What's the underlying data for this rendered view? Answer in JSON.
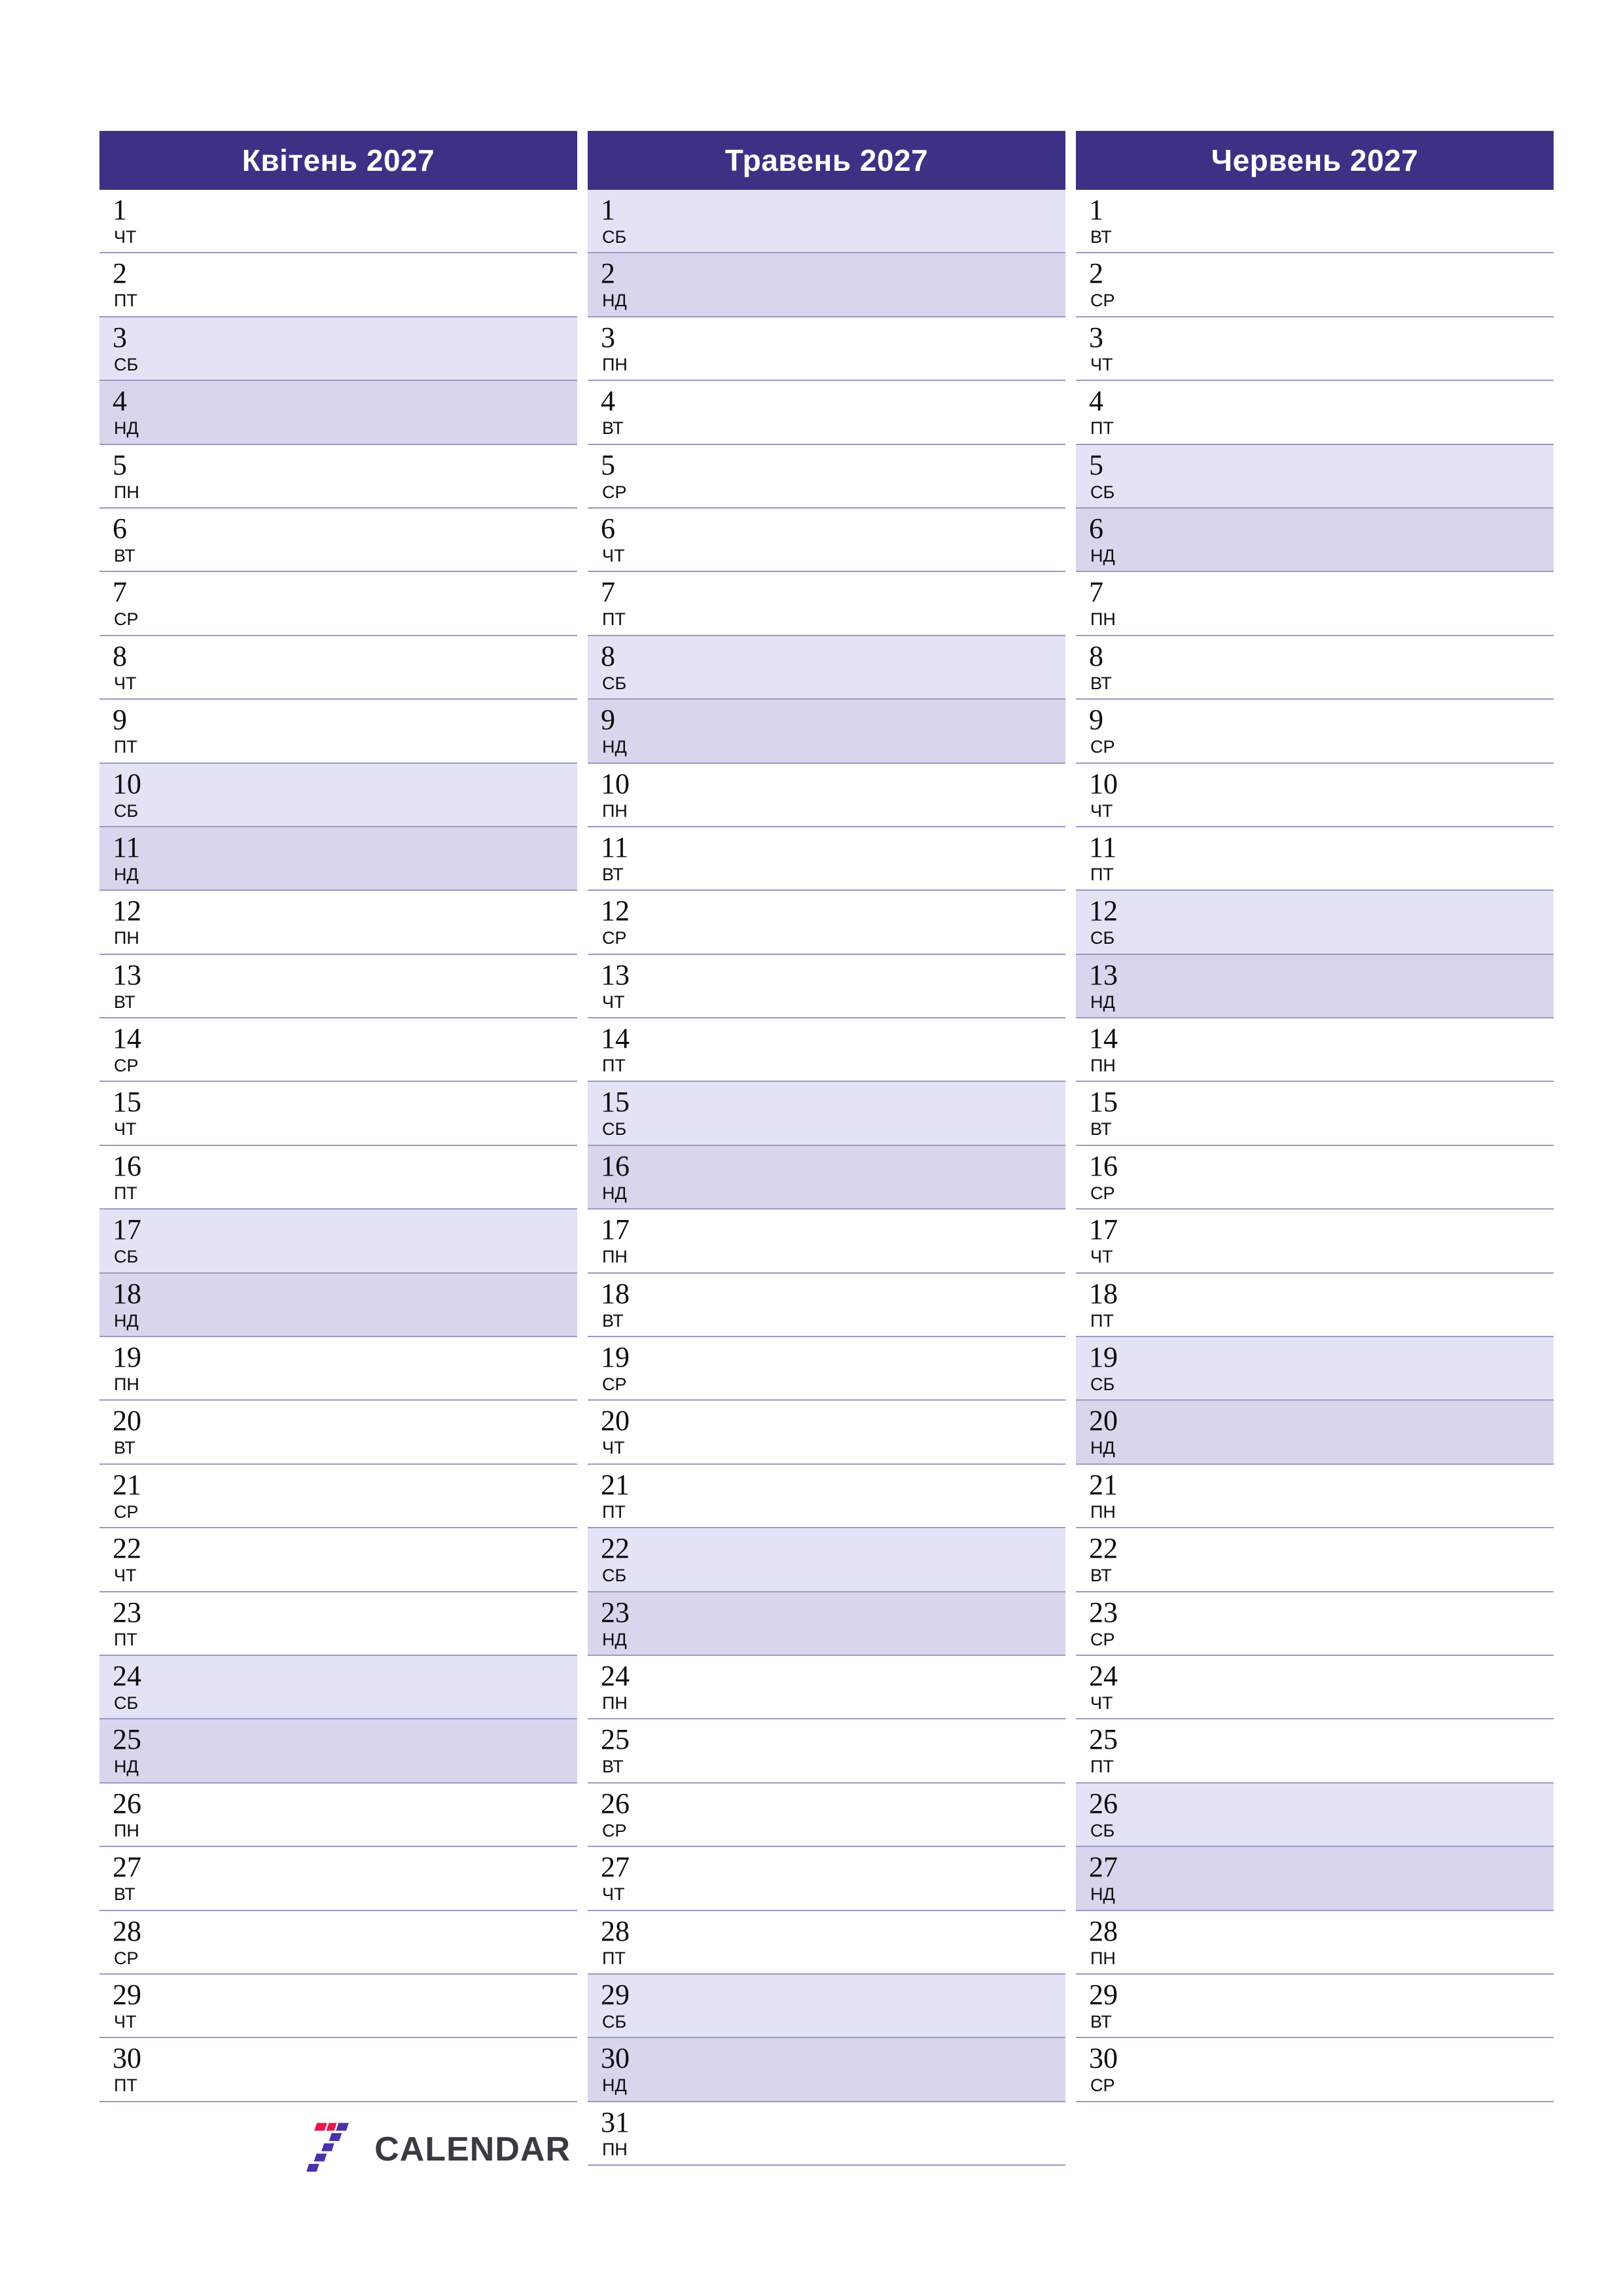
{
  "document": {
    "type": "quarterly-planner",
    "logo": {
      "text": "CALENDAR",
      "mark_colors": [
        "#e8174a",
        "#4b31a8"
      ]
    },
    "colors": {
      "header_bg": "#3b3185",
      "header_text": "#ffffff",
      "saturday_bg": "#e3e3f6",
      "sunday_bg": "#d9d5ec",
      "row_border": "#9a9ac4",
      "day_text": "#0d0d0d"
    }
  },
  "months": [
    {
      "title": "Квітень 2027",
      "days": [
        {
          "num": "1",
          "dow": "ЧТ"
        },
        {
          "num": "2",
          "dow": "ПТ"
        },
        {
          "num": "3",
          "dow": "СБ"
        },
        {
          "num": "4",
          "dow": "НД"
        },
        {
          "num": "5",
          "dow": "ПН"
        },
        {
          "num": "6",
          "dow": "ВТ"
        },
        {
          "num": "7",
          "dow": "СР"
        },
        {
          "num": "8",
          "dow": "ЧТ"
        },
        {
          "num": "9",
          "dow": "ПТ"
        },
        {
          "num": "10",
          "dow": "СБ"
        },
        {
          "num": "11",
          "dow": "НД"
        },
        {
          "num": "12",
          "dow": "ПН"
        },
        {
          "num": "13",
          "dow": "ВТ"
        },
        {
          "num": "14",
          "dow": "СР"
        },
        {
          "num": "15",
          "dow": "ЧТ"
        },
        {
          "num": "16",
          "dow": "ПТ"
        },
        {
          "num": "17",
          "dow": "СБ"
        },
        {
          "num": "18",
          "dow": "НД"
        },
        {
          "num": "19",
          "dow": "ПН"
        },
        {
          "num": "20",
          "dow": "ВТ"
        },
        {
          "num": "21",
          "dow": "СР"
        },
        {
          "num": "22",
          "dow": "ЧТ"
        },
        {
          "num": "23",
          "dow": "ПТ"
        },
        {
          "num": "24",
          "dow": "СБ"
        },
        {
          "num": "25",
          "dow": "НД"
        },
        {
          "num": "26",
          "dow": "ПН"
        },
        {
          "num": "27",
          "dow": "ВТ"
        },
        {
          "num": "28",
          "dow": "СР"
        },
        {
          "num": "29",
          "dow": "ЧТ"
        },
        {
          "num": "30",
          "dow": "ПТ"
        }
      ]
    },
    {
      "title": "Травень 2027",
      "days": [
        {
          "num": "1",
          "dow": "СБ"
        },
        {
          "num": "2",
          "dow": "НД"
        },
        {
          "num": "3",
          "dow": "ПН"
        },
        {
          "num": "4",
          "dow": "ВТ"
        },
        {
          "num": "5",
          "dow": "СР"
        },
        {
          "num": "6",
          "dow": "ЧТ"
        },
        {
          "num": "7",
          "dow": "ПТ"
        },
        {
          "num": "8",
          "dow": "СБ"
        },
        {
          "num": "9",
          "dow": "НД"
        },
        {
          "num": "10",
          "dow": "ПН"
        },
        {
          "num": "11",
          "dow": "ВТ"
        },
        {
          "num": "12",
          "dow": "СР"
        },
        {
          "num": "13",
          "dow": "ЧТ"
        },
        {
          "num": "14",
          "dow": "ПТ"
        },
        {
          "num": "15",
          "dow": "СБ"
        },
        {
          "num": "16",
          "dow": "НД"
        },
        {
          "num": "17",
          "dow": "ПН"
        },
        {
          "num": "18",
          "dow": "ВТ"
        },
        {
          "num": "19",
          "dow": "СР"
        },
        {
          "num": "20",
          "dow": "ЧТ"
        },
        {
          "num": "21",
          "dow": "ПТ"
        },
        {
          "num": "22",
          "dow": "СБ"
        },
        {
          "num": "23",
          "dow": "НД"
        },
        {
          "num": "24",
          "dow": "ПН"
        },
        {
          "num": "25",
          "dow": "ВТ"
        },
        {
          "num": "26",
          "dow": "СР"
        },
        {
          "num": "27",
          "dow": "ЧТ"
        },
        {
          "num": "28",
          "dow": "ПТ"
        },
        {
          "num": "29",
          "dow": "СБ"
        },
        {
          "num": "30",
          "dow": "НД"
        },
        {
          "num": "31",
          "dow": "ПН"
        }
      ]
    },
    {
      "title": "Червень 2027",
      "days": [
        {
          "num": "1",
          "dow": "ВТ"
        },
        {
          "num": "2",
          "dow": "СР"
        },
        {
          "num": "3",
          "dow": "ЧТ"
        },
        {
          "num": "4",
          "dow": "ПТ"
        },
        {
          "num": "5",
          "dow": "СБ"
        },
        {
          "num": "6",
          "dow": "НД"
        },
        {
          "num": "7",
          "dow": "ПН"
        },
        {
          "num": "8",
          "dow": "ВТ"
        },
        {
          "num": "9",
          "dow": "СР"
        },
        {
          "num": "10",
          "dow": "ЧТ"
        },
        {
          "num": "11",
          "dow": "ПТ"
        },
        {
          "num": "12",
          "dow": "СБ"
        },
        {
          "num": "13",
          "dow": "НД"
        },
        {
          "num": "14",
          "dow": "ПН"
        },
        {
          "num": "15",
          "dow": "ВТ"
        },
        {
          "num": "16",
          "dow": "СР"
        },
        {
          "num": "17",
          "dow": "ЧТ"
        },
        {
          "num": "18",
          "dow": "ПТ"
        },
        {
          "num": "19",
          "dow": "СБ"
        },
        {
          "num": "20",
          "dow": "НД"
        },
        {
          "num": "21",
          "dow": "ПН"
        },
        {
          "num": "22",
          "dow": "ВТ"
        },
        {
          "num": "23",
          "dow": "СР"
        },
        {
          "num": "24",
          "dow": "ЧТ"
        },
        {
          "num": "25",
          "dow": "ПТ"
        },
        {
          "num": "26",
          "dow": "СБ"
        },
        {
          "num": "27",
          "dow": "НД"
        },
        {
          "num": "28",
          "dow": "ПН"
        },
        {
          "num": "29",
          "dow": "ВТ"
        },
        {
          "num": "30",
          "dow": "СР"
        }
      ]
    }
  ]
}
